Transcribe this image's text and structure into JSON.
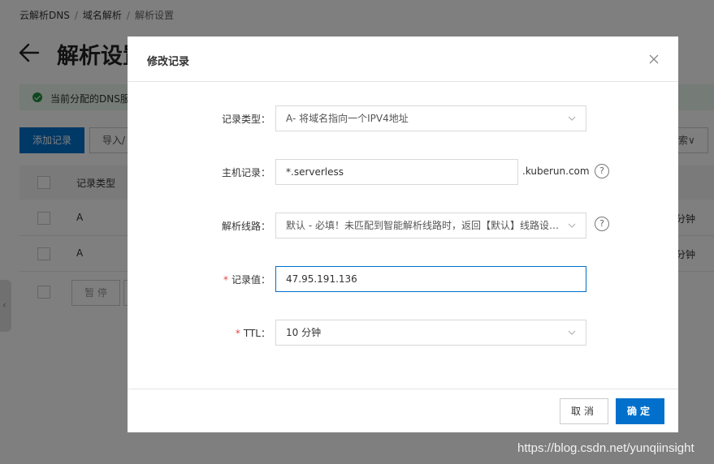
{
  "breadcrumb": {
    "item1": "云解析DNS",
    "item2": "域名解析",
    "item3": "解析设置",
    "sep": "/"
  },
  "page": {
    "title": "解析设置",
    "notice": "当前分配的DNS服",
    "add_button": "添加记录",
    "import_button": "导入/",
    "search_button": "索∨",
    "column_type": "记录类型",
    "rows": [
      {
        "type": "A",
        "ttl": "分钟"
      },
      {
        "type": "A",
        "ttl": "分钟"
      }
    ],
    "pause_button": "暂 停"
  },
  "dialog": {
    "title": "修改记录",
    "fields": {
      "record_type": {
        "label": "记录类型：",
        "value": "A- 将域名指向一个IPV4地址"
      },
      "host": {
        "label": "主机记录：",
        "value": "*.serverless",
        "suffix": ".kuberun.com"
      },
      "line": {
        "label": "解析线路：",
        "value": "默认 - 必填！未匹配到智能解析线路时，返回【默认】线路设…"
      },
      "value": {
        "label": "记录值：",
        "value": "47.95.191.136",
        "required": "*"
      },
      "ttl": {
        "label": "TTL：",
        "value": "10 分钟",
        "required": "*"
      }
    },
    "cancel": "取消",
    "ok": "确定",
    "help": "?"
  },
  "watermark": "https://blog.csdn.net/yunqiinsight",
  "colors": {
    "primary": "#0070cc",
    "required": "#e54545",
    "notice_bg": "#eaf6ec",
    "success": "#1e8e3e"
  },
  "icons": {
    "back": "back-arrow-icon",
    "close": "close-icon",
    "chevron": "chevron-down-icon",
    "help": "help-circle-icon",
    "success": "check-circle-icon"
  }
}
